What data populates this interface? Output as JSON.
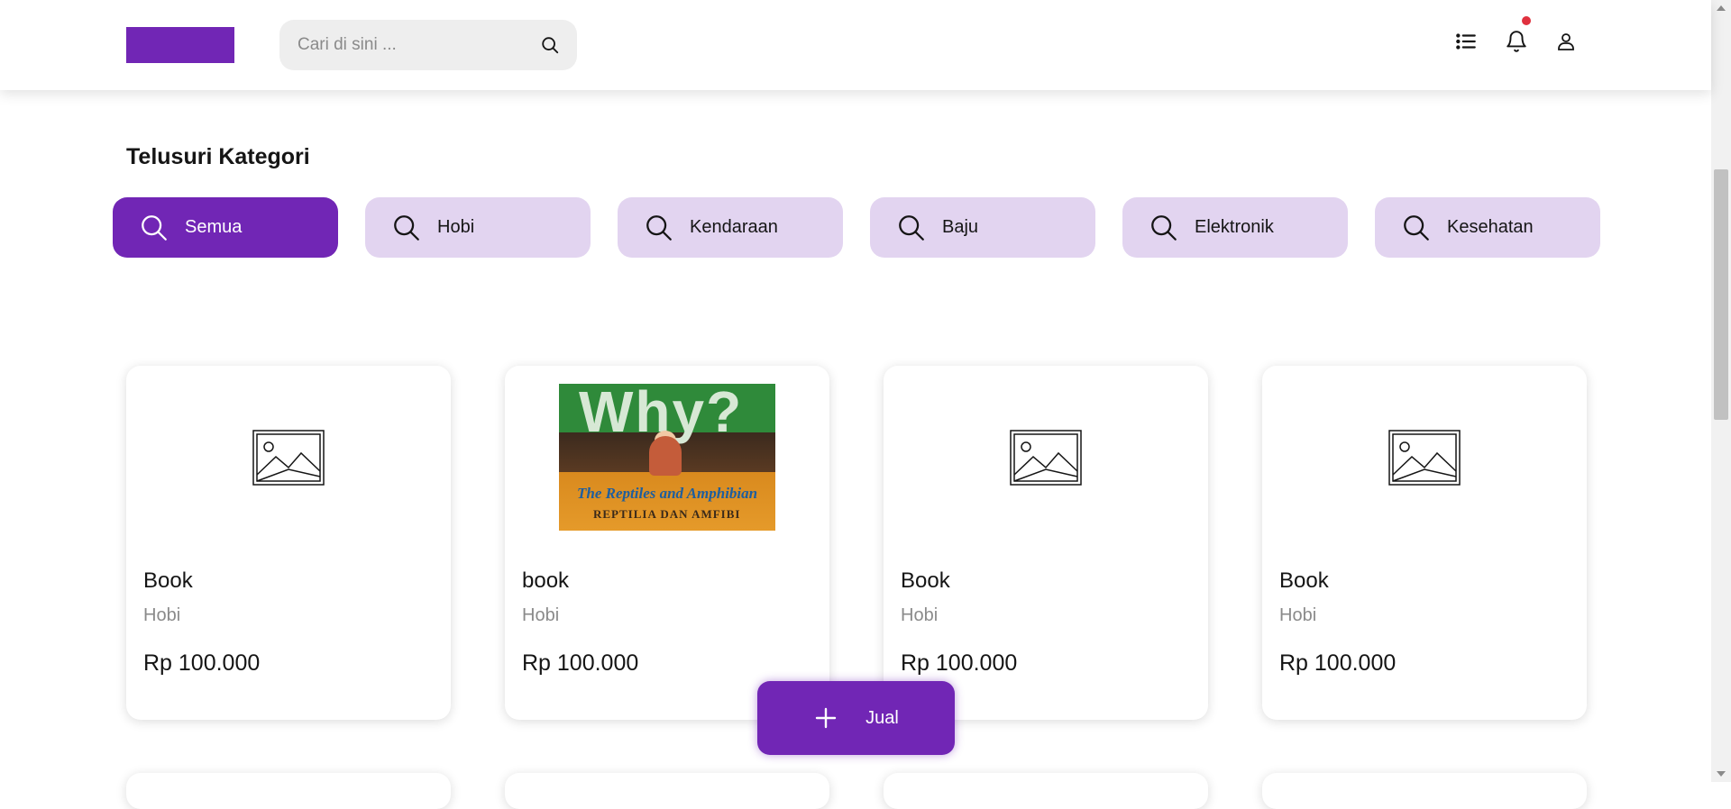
{
  "header": {
    "search_placeholder": "Cari di sini ...",
    "icons": [
      "list-icon",
      "bell-icon",
      "user-icon"
    ]
  },
  "section": {
    "title": "Telusuri Kategori"
  },
  "categories": [
    {
      "label": "Semua",
      "active": true
    },
    {
      "label": "Hobi",
      "active": false
    },
    {
      "label": "Kendaraan",
      "active": false
    },
    {
      "label": "Baju",
      "active": false
    },
    {
      "label": "Elektronik",
      "active": false
    },
    {
      "label": "Kesehatan",
      "active": false
    }
  ],
  "products": [
    {
      "name": "Book",
      "category": "Hobi",
      "price": "Rp 100.000",
      "image": "placeholder-image-icon"
    },
    {
      "name": "book",
      "category": "Hobi",
      "price": "Rp 100.000",
      "image": "book-cover"
    },
    {
      "name": "Book",
      "category": "Hobi",
      "price": "Rp 100.000",
      "image": "placeholder-image-icon"
    },
    {
      "name": "Book",
      "category": "Hobi",
      "price": "Rp 100.000",
      "image": "placeholder-image-icon"
    }
  ],
  "book_cover": {
    "title": "Why?",
    "subtitle": "The Reptiles and Amphibian",
    "subtitle2": "REPTILIA DAN AMFIBI"
  },
  "sell_button": {
    "label": "Jual"
  },
  "colors": {
    "primary": "#7126B5",
    "category_bg": "#E2D4F0",
    "notification_dot": "#E0313E",
    "muted_text": "#8A8A8A"
  }
}
